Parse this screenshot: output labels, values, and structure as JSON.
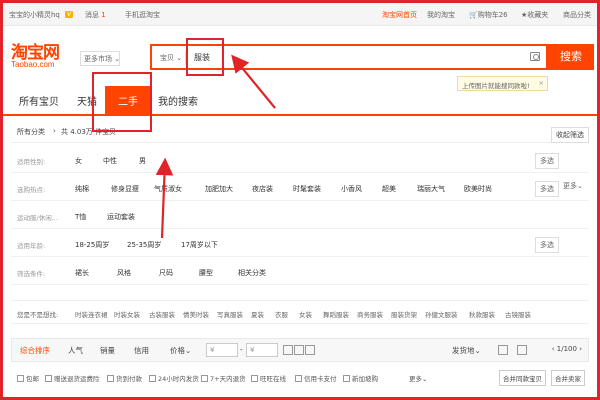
{
  "topbar": {
    "user": "宝宝的小精灵hq",
    "messages": "消息",
    "messages_count": "1",
    "mobile": "手机逛淘宝",
    "home": "淘宝网首页",
    "my_taobao": "我的淘宝",
    "cart": "购物车26",
    "favorites": "收藏夹",
    "categories": "商品分类"
  },
  "header": {
    "logo": "淘宝网",
    "logo_sub": "Taobao.com",
    "more_market": "更多市场"
  },
  "search": {
    "type": "宝贝",
    "value": "服装",
    "button": "搜索",
    "tip": "上传图片就能搜同款啦!"
  },
  "tabs": [
    {
      "label": "所有宝贝"
    },
    {
      "label": "天猫"
    },
    {
      "label": "二手"
    },
    {
      "label": "我的搜索"
    }
  ],
  "breadcrumb": {
    "all": "所有分类",
    "count": "共 4.03万 件宝贝",
    "fold": "收起筛选"
  },
  "filters": {
    "gender": {
      "label": "适用性别:",
      "options": [
        "女",
        "中性",
        "男"
      ],
      "multi": "多选"
    },
    "style": {
      "label": "选购热点:",
      "options": [
        "纯棉",
        "修身显瘦",
        "气质淑女",
        "加肥加大",
        "夜店装",
        "时髦套装",
        "小香风",
        "超美",
        "瑞丽大气",
        "欧美时尚"
      ],
      "multi": "多选",
      "more": "更多"
    },
    "sport": {
      "label": "运动服/休闲...",
      "options": [
        "T恤",
        "运动套装"
      ]
    },
    "age": {
      "label": "适用年龄:",
      "options": [
        "18-25周岁",
        "25-35周岁",
        "17周岁以下"
      ],
      "multi": "多选"
    },
    "conditions": {
      "label": "筛选条件:",
      "options": [
        "裙长",
        "风格",
        "尺码",
        "腰型",
        "相关分类"
      ]
    }
  },
  "guess": {
    "label": "您是不是想找:",
    "items": [
      "时装连衣裙",
      "时装女装",
      "古装服装",
      "情美时装",
      "写真服装",
      "夏装",
      "衣服",
      "女装",
      "舞蹈服装",
      "商务服装",
      "服装货架",
      "孙健文服装",
      "秋款服装",
      "古镜服装"
    ]
  },
  "sortbar": {
    "items": [
      "综合排序",
      "人气",
      "销量",
      "信用",
      "价格"
    ],
    "price_from": "¥",
    "price_to": "¥",
    "ship": "发货地",
    "page": "1/100"
  },
  "checkbar": {
    "items": [
      "包邮",
      "赠送退货运费险",
      "货到付款",
      "24小时内发货",
      "7+天内退货",
      "旺旺在线",
      "信用卡支付",
      "新加坡购"
    ],
    "more": "更多",
    "btn1": "合并同款宝贝",
    "btn2": "合并卖家"
  },
  "colors": {
    "accent": "#ff4400",
    "annotation": "#e0242a"
  }
}
